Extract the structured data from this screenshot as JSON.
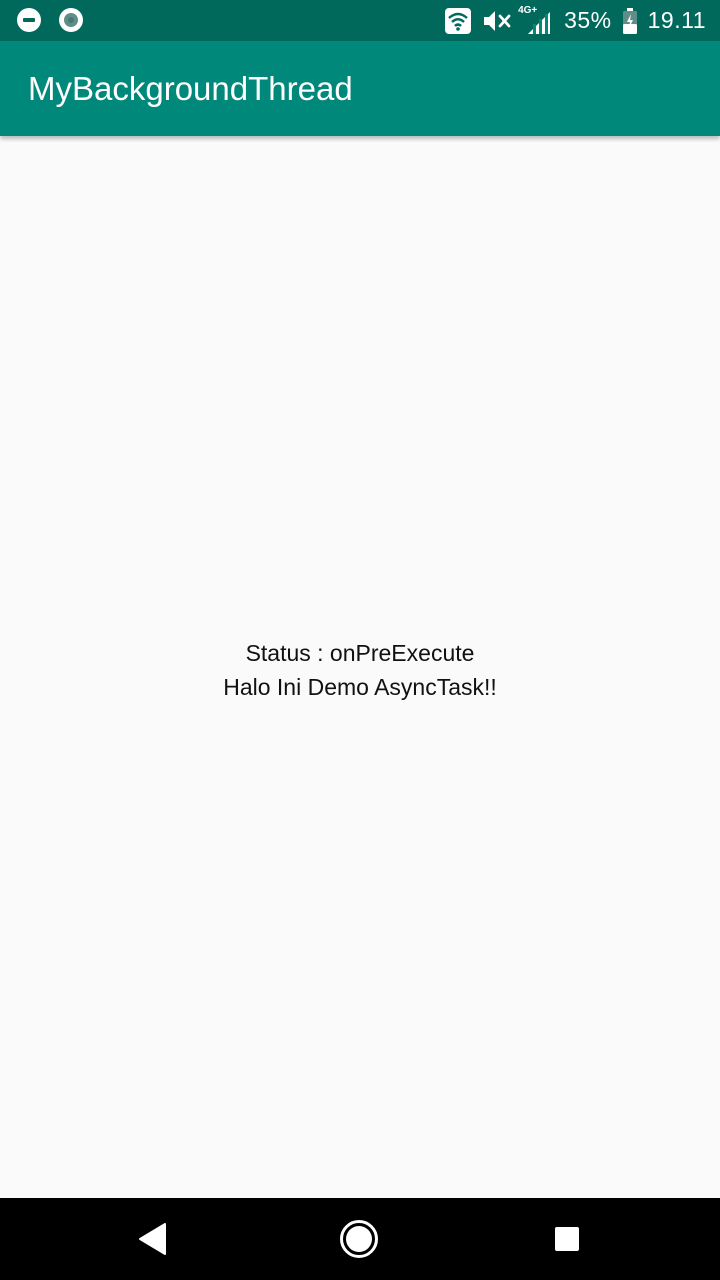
{
  "status_bar": {
    "battery_percent": "35%",
    "time": "19.11",
    "network_type": "4G+",
    "icons": [
      "dnd-icon",
      "sync-icon",
      "wifi-icon",
      "mute-icon",
      "signal-icon",
      "battery-charging-icon"
    ]
  },
  "app_bar": {
    "title": "MyBackgroundThread"
  },
  "content": {
    "status_line": "Status : onPreExecute",
    "message_line": "Halo Ini Demo AsyncTask!!"
  },
  "colors": {
    "status_bar": "#00695c",
    "app_bar": "#00897b",
    "background": "#fafafa",
    "nav_bar": "#000000"
  },
  "nav_bar": {
    "icons": [
      "back-icon",
      "home-icon",
      "recents-icon"
    ]
  }
}
